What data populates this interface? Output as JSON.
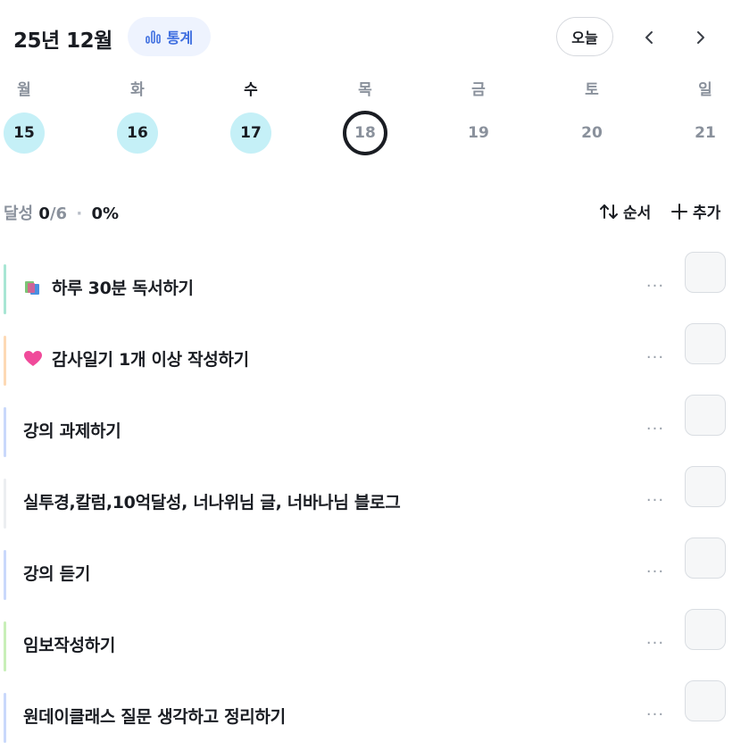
{
  "header": {
    "month_title": "25년 12월",
    "stats_label": "통계",
    "today_label": "오늘"
  },
  "week": {
    "weekdays": [
      "월",
      "화",
      "수",
      "목",
      "금",
      "토",
      "일"
    ],
    "days": [
      {
        "num": "15",
        "state": "done"
      },
      {
        "num": "16",
        "state": "done"
      },
      {
        "num": "17",
        "state": "done"
      },
      {
        "num": "18",
        "state": "current"
      },
      {
        "num": "19",
        "state": "future"
      },
      {
        "num": "20",
        "state": "future"
      },
      {
        "num": "21",
        "state": "future"
      }
    ]
  },
  "summary": {
    "label": "달성",
    "done": "0",
    "total": "/6",
    "separator": "·",
    "percent": "0%",
    "order_label": "순서",
    "add_label": "추가"
  },
  "tasks": [
    {
      "title": "하루 30분 독서하기",
      "emoji": "books-icon",
      "color": "#a8e6d4"
    },
    {
      "title": "감사일기 1개 이상 작성하기",
      "emoji": "heart-icon",
      "color": "#fdd9b5"
    },
    {
      "title": "강의 과제하기",
      "emoji": "",
      "color": "#c9d8fb"
    },
    {
      "title": "실투경,칼럼,10억달성, 너나위님 글, 너바나님 블로그",
      "emoji": "",
      "color": "#eceef1"
    },
    {
      "title": "강의 듣기",
      "emoji": "",
      "color": "#c9d8fb"
    },
    {
      "title": "임보작성하기",
      "emoji": "",
      "color": "#c8efb8"
    },
    {
      "title": "원데이클래스 질문 생각하고 정리하기",
      "emoji": "",
      "color": "#c9d8fb"
    }
  ],
  "colors": {
    "accent": "#3f6fe0",
    "done_day": "#c5f0f7",
    "text": "#1a1d23",
    "muted": "#8a919c"
  }
}
